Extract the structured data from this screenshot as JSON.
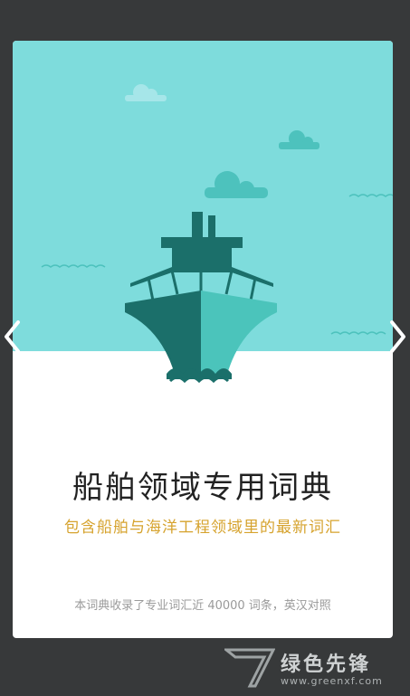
{
  "colors": {
    "background": "#37393a",
    "sky": "#7edcdc",
    "ship_dark": "#1b6f6a",
    "ship_light": "#4bc4bb",
    "cloud": "#4dc2bd",
    "accent": "#d6a32e"
  },
  "card": {
    "title": "船舶领域专用词典",
    "subtitle": "包含船舶与海洋工程领域里的最新词汇",
    "footnote": "本词典收录了专业词汇近 40000 词条，英汉对照"
  },
  "navigation": {
    "prev_icon": "chevron-left-icon",
    "next_icon": "chevron-right-icon"
  },
  "watermark": {
    "text": "绿色先锋",
    "url": "www.greenxf.com"
  }
}
